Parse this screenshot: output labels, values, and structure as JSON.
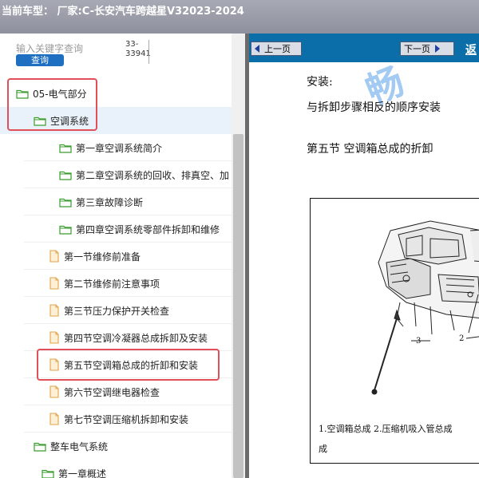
{
  "title_bar": {
    "title": "当前车型： 厂家:C-长安汽车跨越星V32023-2024"
  },
  "search": {
    "placeholder": "输入关键字查询",
    "button_label": "查询",
    "count_line1": "33-",
    "count_line2": "33941"
  },
  "tree": [
    {
      "label": "05-电气部分",
      "icon": "folder-icon",
      "level": 0
    },
    {
      "label": "空调系统",
      "icon": "folder-icon",
      "level": 1,
      "selected": true
    },
    {
      "label": "第一章空调系统简介",
      "icon": "folder-icon",
      "level": 2
    },
    {
      "label": "第二章空调系统的回收、排真空、加",
      "icon": "folder-icon",
      "level": 2
    },
    {
      "label": "第三章故障诊断",
      "icon": "folder-icon",
      "level": 2
    },
    {
      "label": "第四章空调系统零部件拆卸和维修",
      "icon": "folder-icon",
      "level": 2
    },
    {
      "label": "第一节维修前准备",
      "icon": "document-icon",
      "level": 3
    },
    {
      "label": "第二节维修前注意事项",
      "icon": "document-icon",
      "level": 3
    },
    {
      "label": "第三节压力保护开关检查",
      "icon": "document-icon",
      "level": 3
    },
    {
      "label": "第四节空调冷凝器总成拆卸及安装",
      "icon": "document-icon",
      "level": 3
    },
    {
      "label": "第五节空调箱总成的折卸和安装",
      "icon": "document-icon",
      "level": 3
    },
    {
      "label": "第六节空调继电器检查",
      "icon": "document-icon",
      "level": 3
    },
    {
      "label": "第七节空调压缩机拆卸和安装",
      "icon": "document-icon",
      "level": 3
    },
    {
      "label": "整车电气系统",
      "icon": "folder-icon",
      "level": 1
    },
    {
      "label": "第一章概述",
      "icon": "folder-icon",
      "level": 2
    }
  ],
  "viewer": {
    "prev_label": "上一页",
    "next_label": "下一页",
    "extra_label": "返",
    "watermark": "畅",
    "lines": {
      "install_heading": "安装:",
      "install_text": "与拆卸步骤相反的顺序安装",
      "section_title": "第五节  空调箱总成的折卸"
    },
    "figure": {
      "callout_3": "3",
      "callout_2": "2",
      "caption_line1": "1.空调箱总成   2.压缩机吸入管总成",
      "caption_line2": "成"
    }
  },
  "colors": {
    "title_bar": "#9a9ca8",
    "search_button": "#1e6fc2",
    "selected_row": "#e9f2fb",
    "folder_outline": "#3a9c2e",
    "document_fill": "#fdf0d5",
    "highlight_border": "#e0505a",
    "viewer_toolbar": "#0b6ea8"
  }
}
